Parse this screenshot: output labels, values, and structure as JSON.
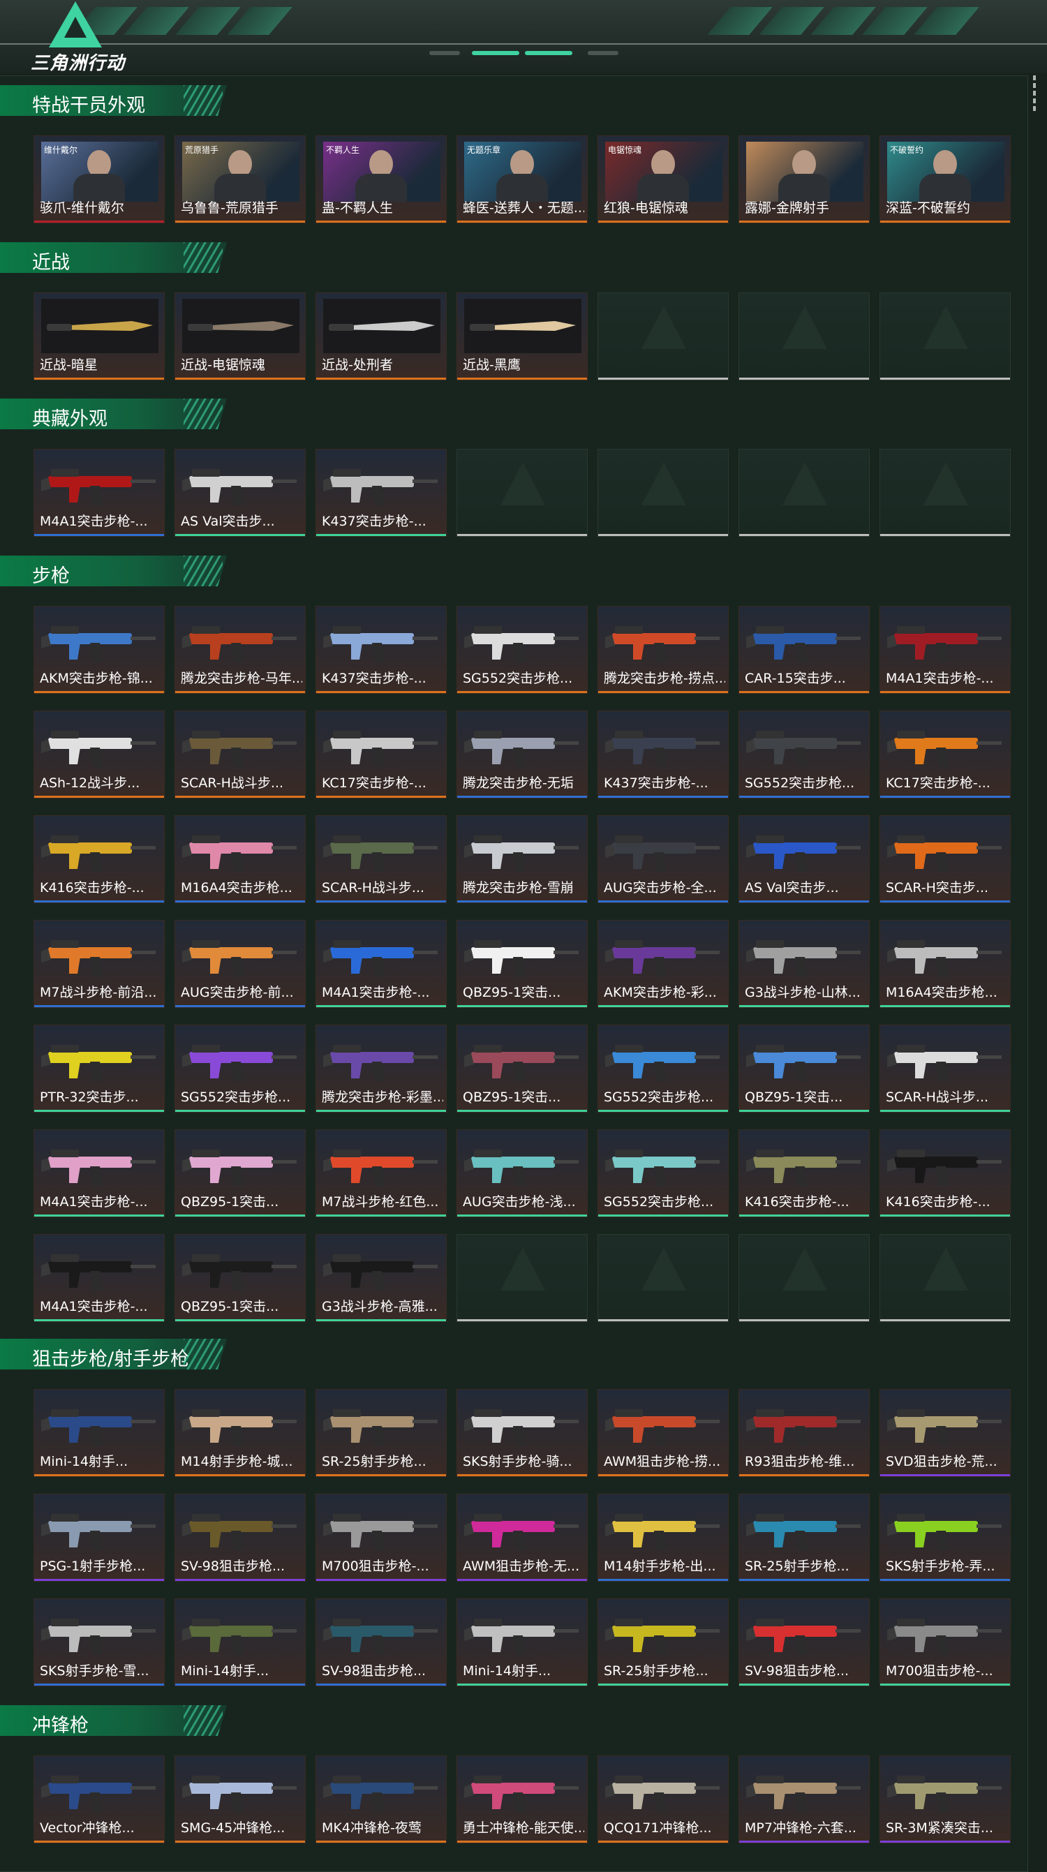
{
  "app": {
    "logo_text": "三角洲行动"
  },
  "rarity_colors": {
    "orange": "#d9731e",
    "red": "#b5202c",
    "blue": "#2d6fd3",
    "green": "#3ed39a",
    "purple": "#7a3fd6",
    "empty": "#bdbdbd"
  },
  "sections": [
    {
      "title": "特战干员外观",
      "items": [
        {
          "label": "骇爪-维什戴尔",
          "rarity": "red",
          "kind": "operator",
          "tag": "维什戴尔",
          "tint": "#5a6f9a"
        },
        {
          "label": "乌鲁鲁-荒原猎手",
          "rarity": "orange",
          "kind": "operator",
          "tag": "荒原猎手",
          "tint": "#7a6a4a"
        },
        {
          "label": "蛊-不羁人生",
          "rarity": "orange",
          "kind": "operator",
          "tag": "不羁人生",
          "tint": "#7a2f8a"
        },
        {
          "label": "蜂医-送葬人・无题...",
          "rarity": "orange",
          "kind": "operator",
          "tag": "无题乐章",
          "tint": "#2e6b8a"
        },
        {
          "label": "红狼-电锯惊魂",
          "rarity": "orange",
          "kind": "operator",
          "tag": "电锯惊魂",
          "tint": "#7a2a2a"
        },
        {
          "label": "露娜-金牌射手",
          "rarity": "orange",
          "kind": "operator",
          "tag": "",
          "tint": "#c08a5a"
        },
        {
          "label": "深蓝-不破誓约",
          "rarity": "orange",
          "kind": "operator",
          "tag": "不破誓约",
          "tint": "#2f8a8a"
        }
      ]
    },
    {
      "title": "近战",
      "items": [
        {
          "label": "近战-暗星",
          "rarity": "orange",
          "kind": "melee",
          "tint": "#c9a54a"
        },
        {
          "label": "近战-电锯惊魂",
          "rarity": "orange",
          "kind": "melee",
          "tint": "#8a7a6a"
        },
        {
          "label": "近战-处刑者",
          "rarity": "orange",
          "kind": "melee",
          "tint": "#cccccc"
        },
        {
          "label": "近战-黑鹰",
          "rarity": "orange",
          "kind": "melee",
          "tint": "#e0c9a0"
        },
        {
          "empty": true
        },
        {
          "empty": true
        },
        {
          "empty": true
        }
      ]
    },
    {
      "title": "典藏外观",
      "items": [
        {
          "label": "M4A1突击步枪-...",
          "rarity": "blue",
          "kind": "gun",
          "tint": "#b01818"
        },
        {
          "label": "AS Val突击步...",
          "rarity": "green",
          "kind": "gun",
          "tint": "#d0d0d0"
        },
        {
          "label": "K437突击步枪-...",
          "rarity": "green",
          "kind": "gun",
          "tint": "#bdbdbd"
        },
        {
          "empty": true
        },
        {
          "empty": true
        },
        {
          "empty": true
        },
        {
          "empty": true
        }
      ]
    },
    {
      "title": "步枪",
      "items": [
        {
          "label": "AKM突击步枪-锦...",
          "rarity": "orange",
          "kind": "gun",
          "tint": "#3e78c8"
        },
        {
          "label": "腾龙突击步枪-马年...",
          "rarity": "orange",
          "kind": "gun",
          "tint": "#b8401e"
        },
        {
          "label": "K437突击步枪-...",
          "rarity": "orange",
          "kind": "gun",
          "tint": "#8aa8d8"
        },
        {
          "label": "SG552突击步枪...",
          "rarity": "orange",
          "kind": "gun",
          "tint": "#dcdcdc"
        },
        {
          "label": "腾龙突击步枪-捞点...",
          "rarity": "orange",
          "kind": "gun",
          "tint": "#d04a28"
        },
        {
          "label": "CAR-15突击步...",
          "rarity": "orange",
          "kind": "gun",
          "tint": "#2a5aa8"
        },
        {
          "label": "M4A1突击步枪-...",
          "rarity": "orange",
          "kind": "gun",
          "tint": "#a01c24"
        },
        {
          "label": "ASh-12战斗步...",
          "rarity": "orange",
          "kind": "gun",
          "tint": "#e0e0e0"
        },
        {
          "label": "SCAR-H战斗步...",
          "rarity": "orange",
          "kind": "gun",
          "tint": "#6a5a3a"
        },
        {
          "label": "KC17突击步枪-...",
          "rarity": "orange",
          "kind": "gun",
          "tint": "#c8c8c8"
        },
        {
          "label": "腾龙突击步枪-无垢",
          "rarity": "blue",
          "kind": "gun",
          "tint": "#9aa0b0"
        },
        {
          "label": "K437突击步枪-...",
          "rarity": "blue",
          "kind": "gun",
          "tint": "#3a4050"
        },
        {
          "label": "SG552突击步枪...",
          "rarity": "blue",
          "kind": "gun",
          "tint": "#404448"
        },
        {
          "label": "KC17突击步枪-...",
          "rarity": "blue",
          "kind": "gun",
          "tint": "#e07a1a"
        },
        {
          "label": "K416突击步枪-...",
          "rarity": "blue",
          "kind": "gun",
          "tint": "#d8a826"
        },
        {
          "label": "M16A4突击步枪...",
          "rarity": "blue",
          "kind": "gun",
          "tint": "#e088a8"
        },
        {
          "label": "SCAR-H战斗步...",
          "rarity": "blue",
          "kind": "gun",
          "tint": "#5a6a4a"
        },
        {
          "label": "腾龙突击步枪-雪崩",
          "rarity": "blue",
          "kind": "gun",
          "tint": "#c8ccd0"
        },
        {
          "label": "AUG突击步枪-全...",
          "rarity": "blue",
          "kind": "gun",
          "tint": "#3a3e44"
        },
        {
          "label": "AS Val突击步...",
          "rarity": "blue",
          "kind": "gun",
          "tint": "#2a58c8"
        },
        {
          "label": "SCAR-H突击步...",
          "rarity": "blue",
          "kind": "gun",
          "tint": "#e06a1a"
        },
        {
          "label": "M7战斗步枪-前沿...",
          "rarity": "blue",
          "kind": "gun",
          "tint": "#e07a2a"
        },
        {
          "label": "AUG突击步枪-前...",
          "rarity": "blue",
          "kind": "gun",
          "tint": "#e08a3a"
        },
        {
          "label": "M4A1突击步枪-...",
          "rarity": "green",
          "kind": "gun",
          "tint": "#2a6ad8"
        },
        {
          "label": "QBZ95-1突击...",
          "rarity": "green",
          "kind": "gun",
          "tint": "#f0f0f0"
        },
        {
          "label": "AKM突击步枪-彩...",
          "rarity": "green",
          "kind": "gun",
          "tint": "#6a3a9a"
        },
        {
          "label": "G3战斗步枪-山林...",
          "rarity": "green",
          "kind": "gun",
          "tint": "#a0a0a0"
        },
        {
          "label": "M16A4突击步枪...",
          "rarity": "green",
          "kind": "gun",
          "tint": "#bcbcbc"
        },
        {
          "label": "PTR-32突击步...",
          "rarity": "green",
          "kind": "gun",
          "tint": "#e0d020"
        },
        {
          "label": "SG552突击步枪...",
          "rarity": "green",
          "kind": "gun",
          "tint": "#8a4ad8"
        },
        {
          "label": "腾龙突击步枪-彩墨...",
          "rarity": "green",
          "kind": "gun",
          "tint": "#6a4aa8"
        },
        {
          "label": "QBZ95-1突击...",
          "rarity": "green",
          "kind": "gun",
          "tint": "#9a4a5a"
        },
        {
          "label": "SG552突击步枪...",
          "rarity": "green",
          "kind": "gun",
          "tint": "#3a8ad8"
        },
        {
          "label": "QBZ95-1突击...",
          "rarity": "green",
          "kind": "gun",
          "tint": "#4a8ad8"
        },
        {
          "label": "SCAR-H战斗步...",
          "rarity": "green",
          "kind": "gun",
          "tint": "#dcdcdc"
        },
        {
          "label": "M4A1突击步枪-...",
          "rarity": "green",
          "kind": "gun",
          "tint": "#e0a0c8"
        },
        {
          "label": "QBZ95-1突击...",
          "rarity": "green",
          "kind": "gun",
          "tint": "#e0a8d0"
        },
        {
          "label": "M7战斗步枪-红色...",
          "rarity": "green",
          "kind": "gun",
          "tint": "#e04a2a"
        },
        {
          "label": "AUG突击步枪-浅...",
          "rarity": "green",
          "kind": "gun",
          "tint": "#6ac0c0"
        },
        {
          "label": "SG552突击步枪...",
          "rarity": "green",
          "kind": "gun",
          "tint": "#7ac8c8"
        },
        {
          "label": "K416突击步枪-...",
          "rarity": "green",
          "kind": "gun",
          "tint": "#8a8a5a"
        },
        {
          "label": "K416突击步枪-...",
          "rarity": "green",
          "kind": "gun",
          "tint": "#181818"
        },
        {
          "label": "M4A1突击步枪-...",
          "rarity": "green",
          "kind": "gun",
          "tint": "#1a1a1a"
        },
        {
          "label": "QBZ95-1突击...",
          "rarity": "green",
          "kind": "gun",
          "tint": "#1c1c1c"
        },
        {
          "label": "G3战斗步枪-高雅...",
          "rarity": "green",
          "kind": "gun",
          "tint": "#1a1a1a"
        },
        {
          "empty": true
        },
        {
          "empty": true
        },
        {
          "empty": true
        },
        {
          "empty": true
        }
      ]
    },
    {
      "title": "狙击步枪/射手步枪",
      "items": [
        {
          "label": "Mini-14射手...",
          "rarity": "orange",
          "kind": "gun",
          "tint": "#2a4a8a"
        },
        {
          "label": "M14射手步枪-城...",
          "rarity": "orange",
          "kind": "gun",
          "tint": "#c8a888"
        },
        {
          "label": "SR-25射手步枪...",
          "rarity": "orange",
          "kind": "gun",
          "tint": "#a89070"
        },
        {
          "label": "SKS射手步枪-骑...",
          "rarity": "orange",
          "kind": "gun",
          "tint": "#d0d0d0"
        },
        {
          "label": "AWM狙击步枪-捞...",
          "rarity": "orange",
          "kind": "gun",
          "tint": "#c84a2a"
        },
        {
          "label": "R93狙击步枪-维...",
          "rarity": "orange",
          "kind": "gun",
          "tint": "#a02a2a"
        },
        {
          "label": "SVD狙击步枪-荒...",
          "rarity": "purple",
          "kind": "gun",
          "tint": "#a89a70"
        },
        {
          "label": "PSG-1射手步枪...",
          "rarity": "purple",
          "kind": "gun",
          "tint": "#8a9ab0"
        },
        {
          "label": "SV-98狙击步枪...",
          "rarity": "purple",
          "kind": "gun",
          "tint": "#6a5a2a"
        },
        {
          "label": "M700狙击步枪-...",
          "rarity": "purple",
          "kind": "gun",
          "tint": "#9a9a9a"
        },
        {
          "label": "AWM狙击步枪-无...",
          "rarity": "purple",
          "kind": "gun",
          "tint": "#d02a9a"
        },
        {
          "label": "M14射手步枪-出...",
          "rarity": "blue",
          "kind": "gun",
          "tint": "#e0c040"
        },
        {
          "label": "SR-25射手步枪...",
          "rarity": "blue",
          "kind": "gun",
          "tint": "#2a8ab0"
        },
        {
          "label": "SKS射手步枪-弄...",
          "rarity": "blue",
          "kind": "gun",
          "tint": "#8ad020"
        },
        {
          "label": "SKS射手步枪-雪...",
          "rarity": "blue",
          "kind": "gun",
          "tint": "#bcbcbc"
        },
        {
          "label": "Mini-14射手...",
          "rarity": "blue",
          "kind": "gun",
          "tint": "#5a6a3a"
        },
        {
          "label": "SV-98狙击步枪...",
          "rarity": "blue",
          "kind": "gun",
          "tint": "#2a5a6a"
        },
        {
          "label": "Mini-14射手...",
          "rarity": "green",
          "kind": "gun",
          "tint": "#c0c0c0"
        },
        {
          "label": "SR-25射手步枪...",
          "rarity": "green",
          "kind": "gun",
          "tint": "#c8b820"
        },
        {
          "label": "SV-98狙击步枪...",
          "rarity": "green",
          "kind": "gun",
          "tint": "#d83030"
        },
        {
          "label": "M700狙击步枪-...",
          "rarity": "green",
          "kind": "gun",
          "tint": "#8a8a8a"
        }
      ]
    },
    {
      "title": "冲锋枪",
      "items": [
        {
          "label": "Vector冲锋枪...",
          "rarity": "orange",
          "kind": "gun",
          "tint": "#2a4a8a"
        },
        {
          "label": "SMG-45冲锋枪...",
          "rarity": "orange",
          "kind": "gun",
          "tint": "#a8b8d8"
        },
        {
          "label": "MK4冲锋枪-夜莺",
          "rarity": "orange",
          "kind": "gun",
          "tint": "#2a4a7a"
        },
        {
          "label": "勇士冲锋枪-能天使...",
          "rarity": "orange",
          "kind": "gun",
          "tint": "#d04a7a"
        },
        {
          "label": "QCQ171冲锋枪...",
          "rarity": "orange",
          "kind": "gun",
          "tint": "#b8b0a0"
        },
        {
          "label": "MP7冲锋枪-六套...",
          "rarity": "purple",
          "kind": "gun",
          "tint": "#a89070"
        },
        {
          "label": "SR-3M紧凑突击...",
          "rarity": "purple",
          "kind": "gun",
          "tint": "#a09a70"
        }
      ]
    }
  ]
}
